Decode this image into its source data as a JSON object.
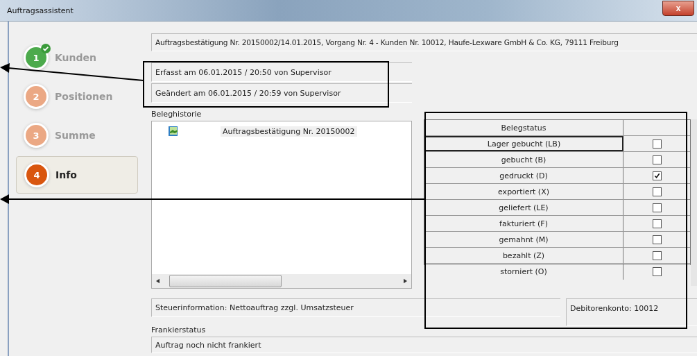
{
  "window": {
    "title": "Auftragsassistent",
    "close": "x"
  },
  "steps": [
    {
      "number": "1",
      "label": "Kunden",
      "selected": false,
      "done": true
    },
    {
      "number": "2",
      "label": "Positionen",
      "selected": false,
      "done": false
    },
    {
      "number": "3",
      "label": "Summe",
      "selected": false,
      "done": false
    },
    {
      "number": "4",
      "label": "Info",
      "selected": true,
      "done": false
    }
  ],
  "header": "Auftragsbestätigung Nr. 20150002/14.01.2015, Vorgang Nr. 4 - Kunden Nr. 10012, Haufe-Lexware GmbH & Co. KG, 79111 Freiburg",
  "created": "Erfasst am 06.01.2015 / 20:50 von Supervisor",
  "changed": "Geändert am 06.01.2015 / 20:59 von Supervisor",
  "history": {
    "label": "Beleghistorie",
    "items": [
      "Auftragsbestätigung Nr. 20150002"
    ]
  },
  "status_table": {
    "columns": [
      "Belegstatus"
    ],
    "rows": [
      {
        "label": "Lager gebucht (LB)",
        "checked": false,
        "selected": true
      },
      {
        "label": "gebucht (B)",
        "checked": false,
        "selected": false
      },
      {
        "label": "gedruckt (D)",
        "checked": true,
        "selected": false
      },
      {
        "label": "exportiert (X)",
        "checked": false,
        "selected": false
      },
      {
        "label": "geliefert (LE)",
        "checked": false,
        "selected": false
      },
      {
        "label": "fakturiert (F)",
        "checked": false,
        "selected": false
      },
      {
        "label": "gemahnt (M)",
        "checked": false,
        "selected": false
      },
      {
        "label": "bezahlt (Z)",
        "checked": false,
        "selected": false
      },
      {
        "label": "storniert (O)",
        "checked": false,
        "selected": false
      }
    ]
  },
  "tax_info": "Steuerinformation: Nettoauftrag zzgl. Umsatzsteuer",
  "debtor_account": "Debitorenkonto: 10012",
  "postage": {
    "label": "Frankierstatus",
    "value": "Auftrag noch nicht frankiert"
  }
}
